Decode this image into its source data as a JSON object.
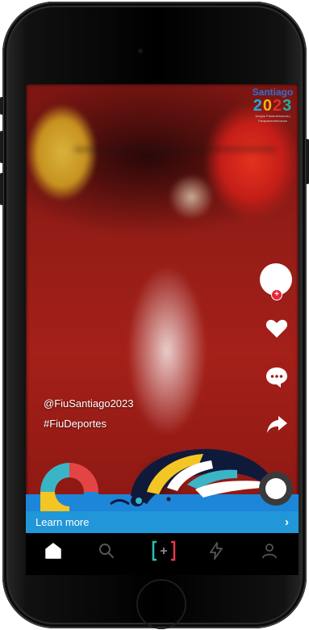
{
  "device": {
    "model": "phone-mockup"
  },
  "video": {
    "event_logo": {
      "line1": "Santiago",
      "line2": "2023",
      "line3": "Juegos Panamericanos | Parapanamericanos"
    },
    "username": "@FiuSantiago2023",
    "hashtag": "#FiuDeportes"
  },
  "actions": {
    "avatar": "profile-avatar",
    "follow": "+",
    "like": "heart-icon",
    "comment": "comment-icon",
    "share": "share-icon"
  },
  "cta": {
    "label": "Learn more",
    "chevron": "›"
  },
  "bottom_nav": [
    {
      "name": "home",
      "icon": "home-icon",
      "active": true
    },
    {
      "name": "discover",
      "icon": "search-icon",
      "active": false
    },
    {
      "name": "create",
      "icon": "plus-icon",
      "active": false
    },
    {
      "name": "activity",
      "icon": "bolt-icon",
      "active": false
    },
    {
      "name": "profile",
      "icon": "person-icon",
      "active": false
    }
  ],
  "colors": {
    "accent_blue": "#2196d8",
    "follow_red": "#e8253a",
    "nav_bg": "#000000"
  }
}
